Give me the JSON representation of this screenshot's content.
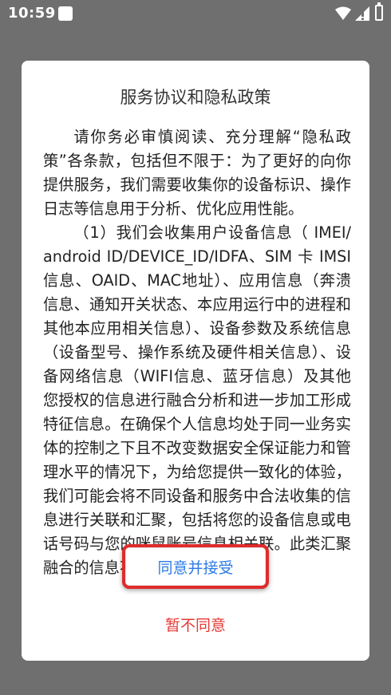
{
  "status_bar": {
    "time": "10:59",
    "icons": [
      "notification-square-icon",
      "wifi-icon",
      "signal-icon",
      "battery-icon"
    ]
  },
  "dialog": {
    "title": "服务协议和隐私政策",
    "paragraphs": [
      "请你务必审慎阅读、充分理解“隐私政策”各条款，包括但不限于：为了更好的向你提供服务，我们需要收集你的设备标识、操作日志等信息用于分析、优化应用性能。",
      "（1）我们会收集用户设备信息（ IMEI/ android ID/DEVICE_ID/IDFA、SIM 卡 IMSI 信息、OAID、MAC地址）、应用信息（奔溃信息、通知开关状态、本应用运行中的进程和其他本应用相关信息）、设备参数及系统信息（设备型号、操作系统及硬件相关信息）、设备网络信息（WIFI信息、蓝牙信息）及其他您授权的信息进行融合分析和进一步加工形成特征信息。在确保个人信息均处于同一业务实体的控制之下且不改变数据安全保证能力和管理水平的情况下，为给您提供一致化的体验，我们可能会将不同设备和服务中合法收集的信息进行关联和汇聚，包括将您的设备信息或电话号码与您的咪鼠账号信息相关联。此类汇聚融合的信息不包含可以直接识"
    ],
    "accept_label": "同意并接受",
    "reject_label": "暂不同意"
  },
  "colors": {
    "overlay": "#6f6f6f",
    "accept_text": "#2b7be6",
    "reject_text": "#e53935",
    "highlight_border": "#e02b2b"
  }
}
